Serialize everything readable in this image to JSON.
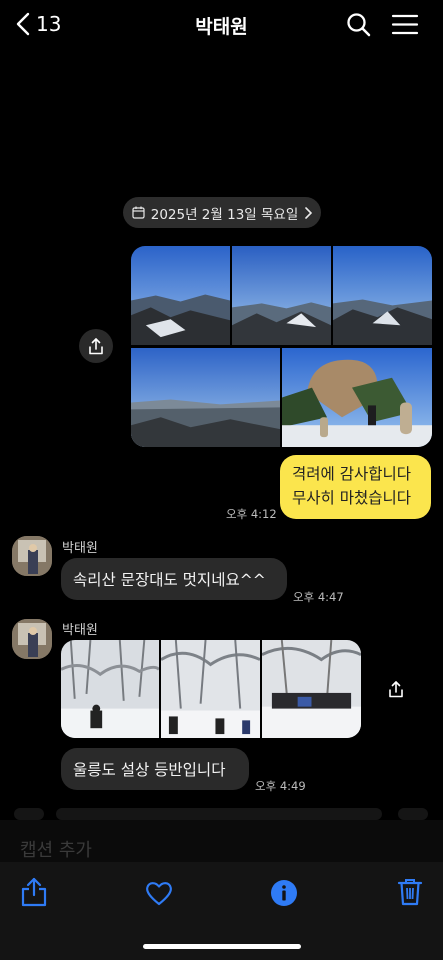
{
  "header": {
    "back_count": "13",
    "title": "박태원",
    "icons": {
      "back": "chevron-left-icon",
      "search": "search-icon",
      "menu": "hamburger-menu-icon"
    }
  },
  "chat": {
    "date_divider": "2025년 2월 13일 목요일",
    "messages": [
      {
        "from": "me",
        "type": "photos",
        "photo_count": 5
      },
      {
        "from": "me",
        "type": "text",
        "lines": [
          "격려에 감사합니다",
          "무사히 마쳤습니다"
        ],
        "time": "오후 4:12"
      },
      {
        "from": "박태원",
        "type": "text",
        "text": "속리산 문장대도 멋지네요^^",
        "time": "오후 4:47"
      },
      {
        "from": "박태원",
        "type": "photos",
        "photo_count": 3
      },
      {
        "from": "박태원",
        "type": "text",
        "text": "울릉도 설상 등반입니다",
        "time": "오후 4:49"
      }
    ]
  },
  "caption": {
    "placeholder": "캡션 추가"
  },
  "toolbar": {
    "icons": [
      "share-icon",
      "heart-icon",
      "info-icon",
      "trash-icon"
    ],
    "accent_color": "#2f7bf5"
  },
  "colors": {
    "my_bubble": "#fbe54d",
    "their_bubble": "#2a2a2a",
    "background": "#000000"
  }
}
